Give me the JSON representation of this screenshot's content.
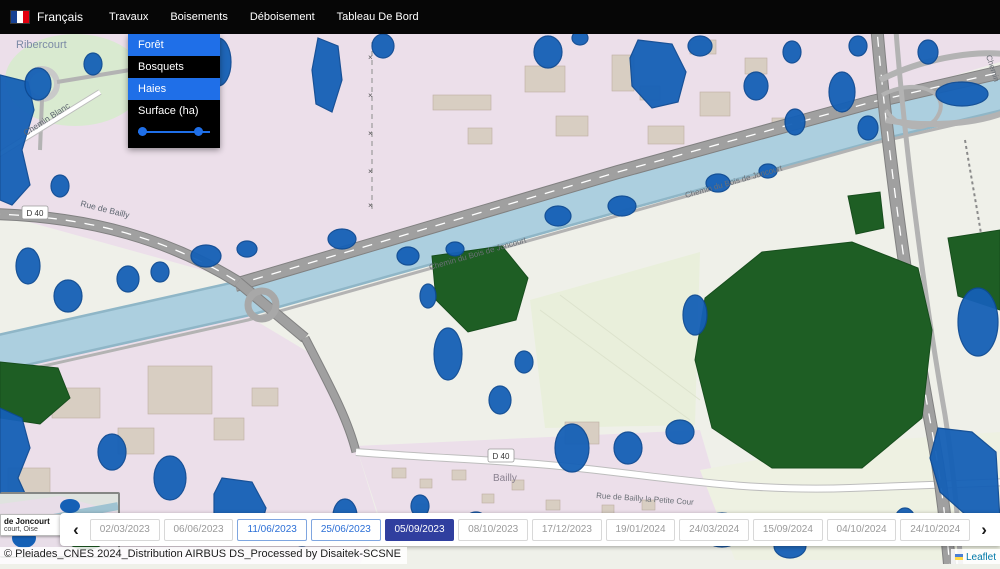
{
  "colors": {
    "navbar_bg": "#060606",
    "menu_highlight": "#1f6fe8",
    "overlay_blue": "#1560b6",
    "overlay_blue_edge": "#0d4a93",
    "forest_green": "#1e5e24",
    "canal_blue": "#accfdf",
    "urban_pink": "#ecdfea",
    "selected_date_bg": "#303f9f",
    "date_available": "#2c6fd6"
  },
  "navbar": {
    "language": "Français",
    "items": [
      {
        "label": "Travaux"
      },
      {
        "label": "Boisements"
      },
      {
        "label": "Déboisement"
      },
      {
        "label": "Tableau De Bord"
      }
    ]
  },
  "dropdown": {
    "items": [
      {
        "label": "Forêt",
        "active": true
      },
      {
        "label": "Bosquets",
        "active": false
      },
      {
        "label": "Haies",
        "active": true
      },
      {
        "label": "Surface (ha)",
        "active": false
      }
    ]
  },
  "map": {
    "labels": {
      "town": "Ribercourt",
      "chemin_blanc": "Chemin Blanc",
      "rue_de_bailly": "Rue de Bailly",
      "canal_road_1": "Chemin du Bois de Joncourt",
      "canal_road_2": "Chemin du Bois de Joncourt",
      "village": "Bailly",
      "village_road": "Rue de Bailly la Petite Cour",
      "shield_d40_left": "D 40",
      "shield_d40_village": "D 40",
      "right_edge_road": "Chemin"
    },
    "attribution": "© Pleiades_CNES 2024_Distribution AIRBUS DS_Processed by Disaitek-SCSNE",
    "leaflet_attribution": "Leaflet"
  },
  "minimap": {
    "line1": "de Joncourt",
    "line2": "court, Oise"
  },
  "timeline": {
    "prev_label": "‹",
    "next_label": "›",
    "dates": [
      {
        "label": "02/03/2023",
        "state": "disabled"
      },
      {
        "label": "06/06/2023",
        "state": "disabled"
      },
      {
        "label": "11/06/2023",
        "state": "available"
      },
      {
        "label": "25/06/2023",
        "state": "available"
      },
      {
        "label": "05/09/2023",
        "state": "selected"
      },
      {
        "label": "08/10/2023",
        "state": "disabled"
      },
      {
        "label": "17/12/2023",
        "state": "disabled"
      },
      {
        "label": "19/01/2024",
        "state": "disabled"
      },
      {
        "label": "24/03/2024",
        "state": "disabled"
      },
      {
        "label": "15/09/2024",
        "state": "disabled"
      },
      {
        "label": "04/10/2024",
        "state": "disabled"
      },
      {
        "label": "24/10/2024",
        "state": "disabled"
      }
    ]
  }
}
